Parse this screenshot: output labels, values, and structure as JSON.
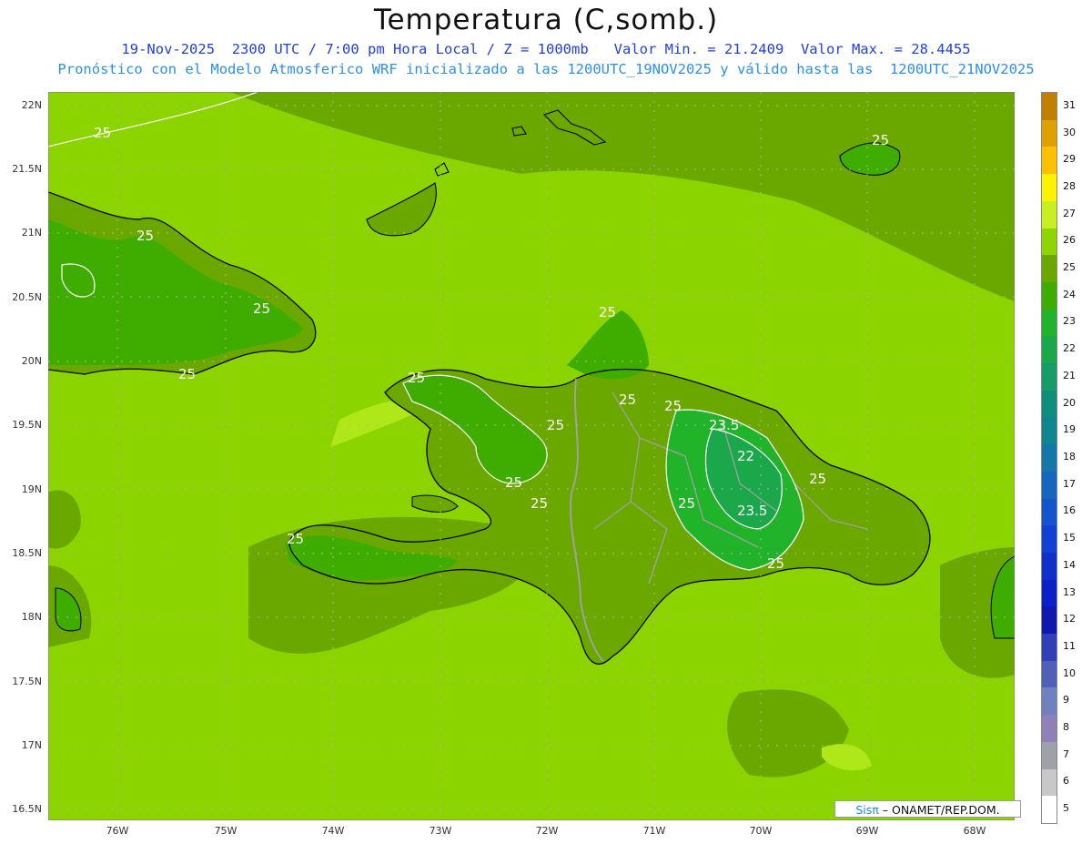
{
  "header": {
    "title": "Temperatura (C,somb.)",
    "line1": "19-Nov-2025  2300 UTC / 7:00 pm Hora Local / Z = 1000mb   Valor Min. = 21.2409  Valor Max. = 28.4455",
    "line2": "Pronóstico con el Modelo Atmosferico WRF inicializado a las 1200UTC_19NOV2025 y válido hasta las  1200UTC_21NOV2025"
  },
  "axes": {
    "y_labels": [
      "22N",
      "21.5N",
      "21N",
      "20.5N",
      "20N",
      "19.5N",
      "19N",
      "18.5N",
      "18N",
      "17.5N",
      "17N",
      "16.5N"
    ],
    "x_labels": [
      "76W",
      "75W",
      "74W",
      "73W",
      "72W",
      "71W",
      "70W",
      "69W",
      "68W"
    ]
  },
  "map": {
    "contour_labels": [
      "25",
      "25",
      "25",
      "25",
      "25",
      "25",
      "25",
      "25",
      "25",
      "25",
      "25",
      "25",
      "25",
      "25",
      "25",
      "25",
      "23.5",
      "22",
      "23.5",
      "25"
    ]
  },
  "legend": {
    "labels": [
      "31",
      "30",
      "29",
      "28",
      "27",
      "26",
      "25",
      "24",
      "23",
      "22",
      "21",
      "20",
      "19",
      "18",
      "17",
      "16",
      "15",
      "14",
      "13",
      "12",
      "11",
      "10",
      "9",
      "8",
      "7",
      "6",
      "5"
    ],
    "colors": [
      "#c27f00",
      "#e0a000",
      "#ffc000",
      "#fff200",
      "#c8f020",
      "#8fd600",
      "#6aa800",
      "#3fac00",
      "#21b42a",
      "#1aa84a",
      "#169c69",
      "#0e8e7d",
      "#108691",
      "#1377a9",
      "#1566bf",
      "#1554cf",
      "#1240d6",
      "#1030cc",
      "#0a20c8",
      "#1018b0",
      "#3040b8",
      "#5060b8",
      "#7080c0",
      "#9080b8",
      "#a0a0a8",
      "#c8c8c8",
      "#ffffff"
    ]
  },
  "credit": {
    "brand": "Sisπ",
    "text": " – ONAMET/REP.DOM."
  }
}
